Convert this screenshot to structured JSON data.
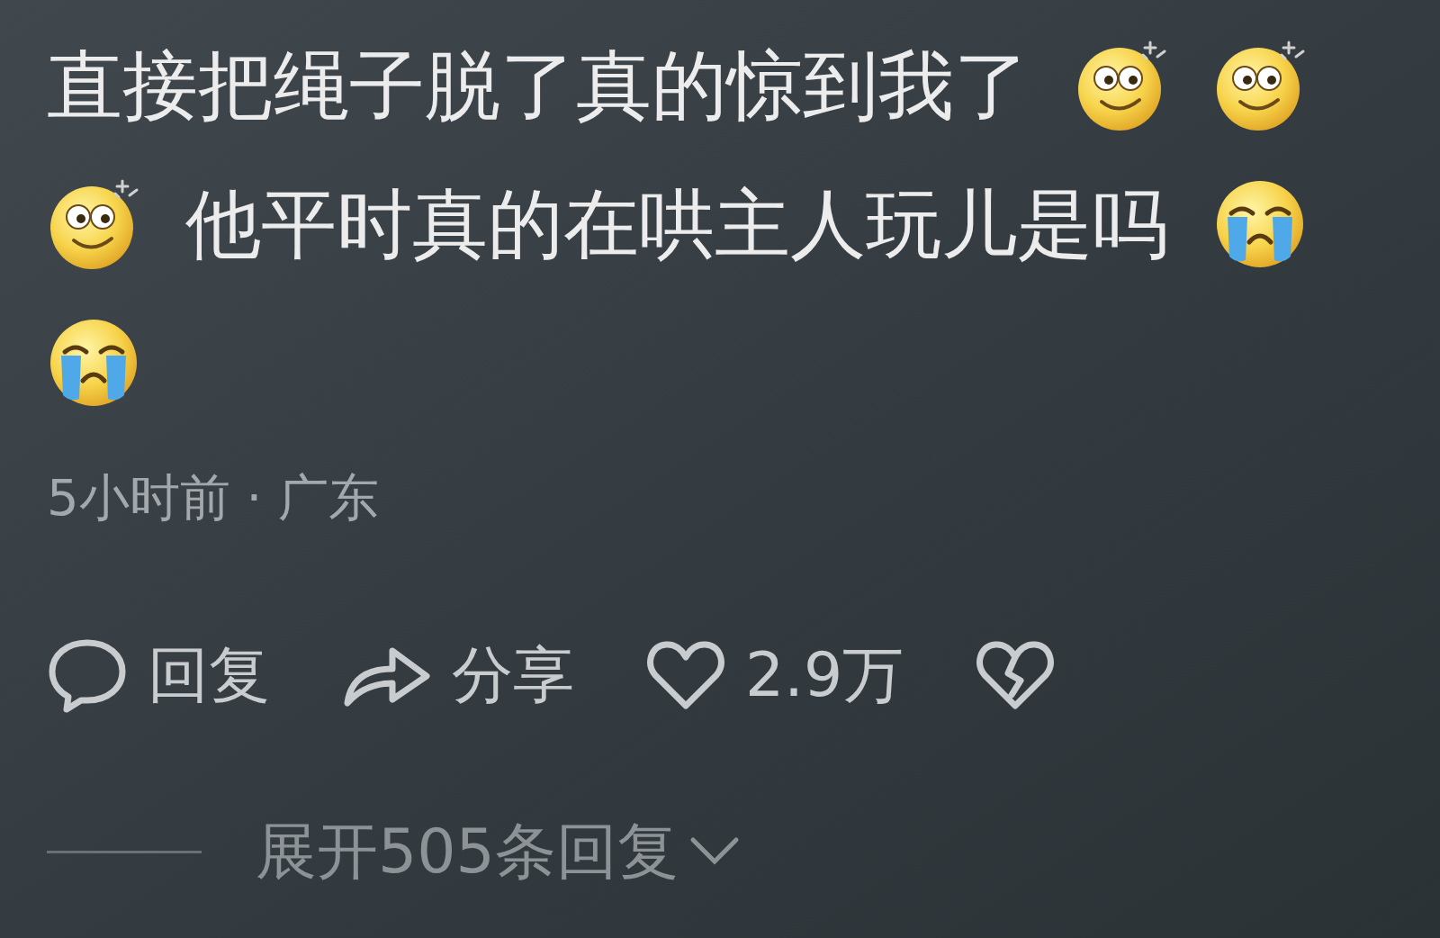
{
  "comment": {
    "lines": [
      [
        {
          "kind": "text",
          "text": "直接把绳子脱了真的惊到我了"
        },
        {
          "kind": "dazed"
        },
        {
          "kind": "dazed"
        }
      ],
      [
        {
          "kind": "dazed"
        },
        {
          "kind": "text",
          "text": "他平时真的在哄主人玩儿是吗"
        },
        {
          "kind": "crying"
        }
      ],
      [
        {
          "kind": "crying"
        }
      ]
    ],
    "meta": "5小时前 · 广东",
    "actions": [
      {
        "kind": "reply",
        "label": "回复"
      },
      {
        "kind": "share",
        "label": "分享"
      },
      {
        "kind": "like",
        "label": "2.9万"
      },
      {
        "kind": "dislike"
      }
    ],
    "expand": "展开505条回复"
  }
}
